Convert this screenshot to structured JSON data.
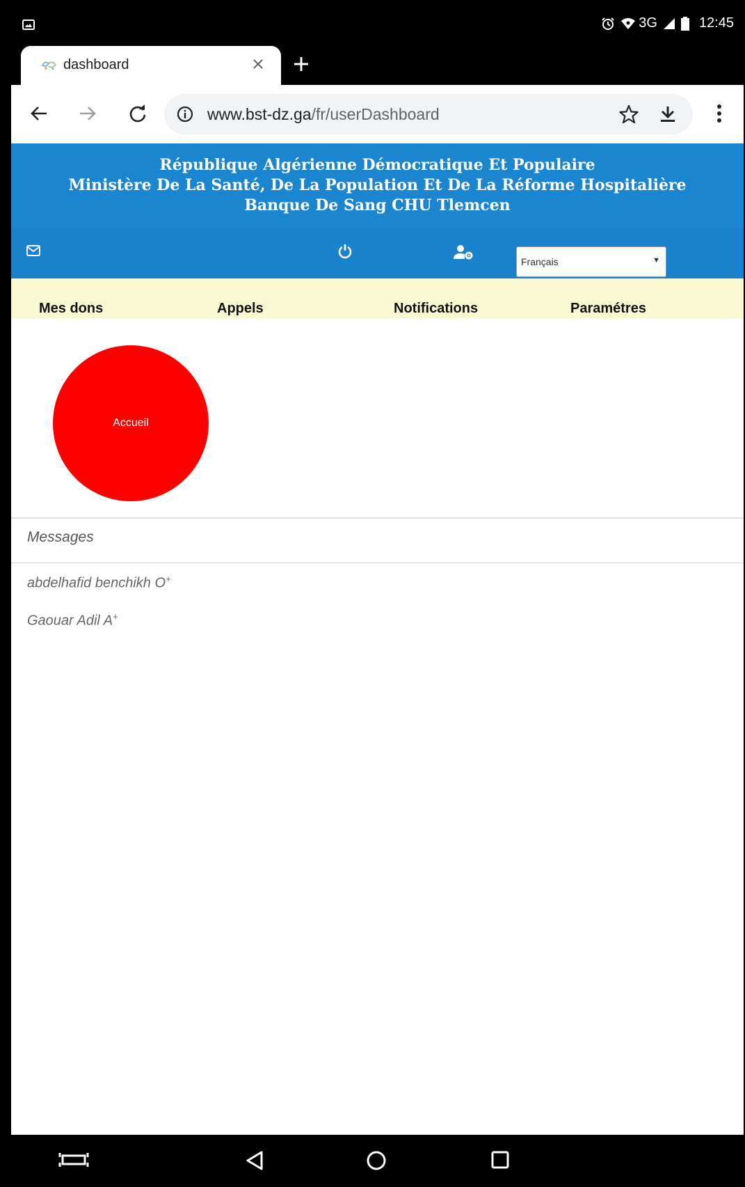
{
  "status_bar": {
    "time": "12:45",
    "network": "3G",
    "icons": [
      "image-icon",
      "alarm-icon",
      "wifi-vpn-icon",
      "signal-icon",
      "battery-icon"
    ]
  },
  "browser": {
    "tab": {
      "title": "dashboard",
      "favicon": "site-favicon"
    },
    "url": {
      "domain": "www.bst-dz.ga",
      "path": "/fr/userDashboard"
    },
    "toolbar_icons": [
      "back-icon",
      "forward-icon",
      "reload-icon",
      "info-icon",
      "star-icon",
      "download-icon",
      "more-icon"
    ]
  },
  "banner": {
    "line1": "République Algérienne Démocratique Et Populaire",
    "line2": "Ministère De La Santé, De La Population Et De La Réforme Hospitalière",
    "line3": "Banque De Sang CHU Tlemcen"
  },
  "icon_nav": {
    "icons": [
      "envelope-icon",
      "power-icon",
      "user-cog-icon"
    ],
    "language": {
      "selected": "Français"
    }
  },
  "menu": {
    "items": [
      "Mes dons",
      "Appels",
      "Notifications",
      "Paramétres"
    ]
  },
  "home": {
    "label": "Accueil",
    "color": "#ff0000"
  },
  "messages": {
    "heading": "Messages",
    "items": [
      {
        "name": "abdelhafid benchikh O",
        "blood_type": "+"
      },
      {
        "name": "Gaouar Adil A",
        "blood_type": "+"
      }
    ]
  },
  "colors": {
    "banner": "#1b86cf",
    "menu_bg": "#fafad2",
    "accent": "#ff0000"
  }
}
